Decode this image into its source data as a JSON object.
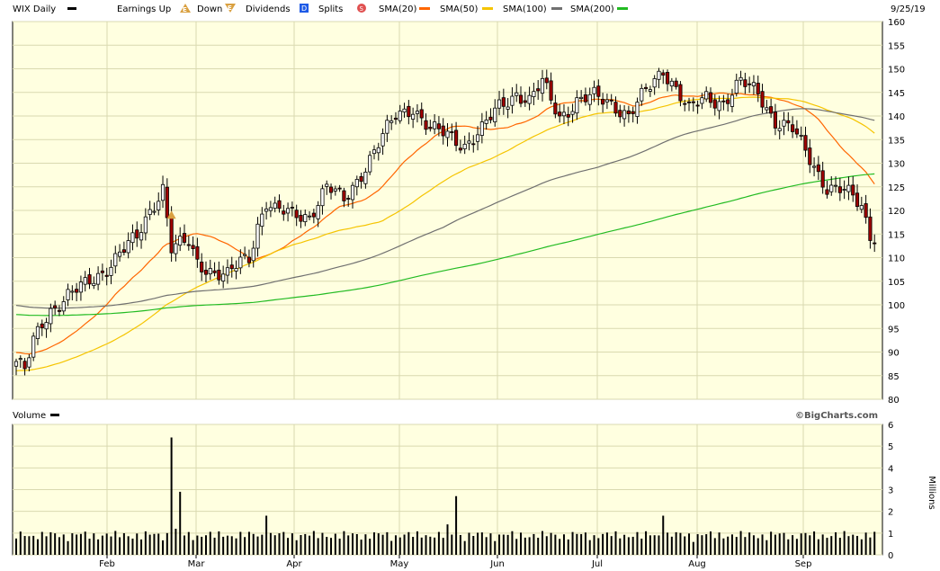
{
  "header": {
    "ticker_label": "WIX Daily",
    "earnings_up_label": "Earnings Up",
    "down_label": "Down",
    "dividends_label": "Dividends",
    "splits_label": "Splits",
    "date": "9/25/19",
    "earnings_marker_letter": "E",
    "dividend_marker_letter": "D",
    "split_marker_letter": "S"
  },
  "volume_header": {
    "label": "Volume"
  },
  "watermark": "©BigCharts.com",
  "colors": {
    "plot_bg": "#ffffe0",
    "grid": "#d9d9b0",
    "up_candle": "#ffffff",
    "down_candle": "#a00000",
    "sma20": "#ff6600",
    "sma50": "#f5c400",
    "sma100": "#707070",
    "sma200": "#22bb22",
    "earnings_marker": "#d9a040",
    "dividend_marker": "#1e5ae6",
    "split_marker": "#e05050"
  },
  "chart_data": [
    {
      "type": "candlestick",
      "title": "WIX Daily",
      "date_range": [
        "2019-01-16",
        "2019-09-25"
      ],
      "ylim": [
        80,
        160
      ],
      "y_ticks": [
        80,
        85,
        90,
        95,
        100,
        105,
        110,
        115,
        120,
        125,
        130,
        135,
        140,
        145,
        150,
        155,
        160
      ],
      "x_tick_labels": [
        "Feb",
        "Mar",
        "Apr",
        "May",
        "Jun",
        "Jul",
        "Aug",
        "Sep"
      ],
      "grid": true,
      "legend": [
        "SMA(20)",
        "SMA(50)",
        "SMA(100)",
        "SMA(200)"
      ],
      "price_anchors": [
        {
          "d": 0,
          "c": 88
        },
        {
          "d": 2,
          "c": 86
        },
        {
          "d": 4,
          "c": 92
        },
        {
          "d": 6,
          "c": 96
        },
        {
          "d": 8,
          "c": 99
        },
        {
          "d": 12,
          "c": 102
        },
        {
          "d": 16,
          "c": 104
        },
        {
          "d": 20,
          "c": 107
        },
        {
          "d": 24,
          "c": 111
        },
        {
          "d": 28,
          "c": 114
        },
        {
          "d": 31,
          "c": 120
        },
        {
          "d": 34,
          "c": 125
        },
        {
          "d": 36,
          "c": 112
        },
        {
          "d": 40,
          "c": 113
        },
        {
          "d": 42,
          "c": 109
        },
        {
          "d": 46,
          "c": 107
        },
        {
          "d": 49,
          "c": 106
        },
        {
          "d": 52,
          "c": 109
        },
        {
          "d": 54,
          "c": 110
        },
        {
          "d": 56,
          "c": 117
        },
        {
          "d": 58,
          "c": 122
        },
        {
          "d": 60,
          "c": 120
        },
        {
          "d": 64,
          "c": 119
        },
        {
          "d": 68,
          "c": 119
        },
        {
          "d": 72,
          "c": 125
        },
        {
          "d": 76,
          "c": 122
        },
        {
          "d": 80,
          "c": 128
        },
        {
          "d": 84,
          "c": 134
        },
        {
          "d": 88,
          "c": 140
        },
        {
          "d": 92,
          "c": 142
        },
        {
          "d": 96,
          "c": 137
        },
        {
          "d": 100,
          "c": 136
        },
        {
          "d": 104,
          "c": 134
        },
        {
          "d": 108,
          "c": 137
        },
        {
          "d": 112,
          "c": 142
        },
        {
          "d": 116,
          "c": 145
        },
        {
          "d": 119,
          "c": 143
        },
        {
          "d": 122,
          "c": 147
        },
        {
          "d": 126,
          "c": 140
        },
        {
          "d": 130,
          "c": 143
        },
        {
          "d": 134,
          "c": 144
        },
        {
          "d": 138,
          "c": 143
        },
        {
          "d": 142,
          "c": 140
        },
        {
          "d": 146,
          "c": 145
        },
        {
          "d": 150,
          "c": 150
        },
        {
          "d": 153,
          "c": 146
        },
        {
          "d": 156,
          "c": 141
        },
        {
          "d": 160,
          "c": 144
        },
        {
          "d": 164,
          "c": 143
        },
        {
          "d": 168,
          "c": 147
        },
        {
          "d": 172,
          "c": 145
        },
        {
          "d": 176,
          "c": 139
        },
        {
          "d": 180,
          "c": 137
        },
        {
          "d": 184,
          "c": 131
        },
        {
          "d": 188,
          "c": 125
        },
        {
          "d": 192,
          "c": 124
        },
        {
          "d": 196,
          "c": 121
        },
        {
          "d": 198,
          "c": 115
        }
      ],
      "series": [
        {
          "name": "SMA(20)"
        },
        {
          "name": "SMA(50)"
        },
        {
          "name": "SMA(100)"
        },
        {
          "name": "SMA(200)"
        }
      ]
    },
    {
      "type": "bar",
      "title": "Volume",
      "ylabel": "Millions",
      "ylim": [
        0,
        6
      ],
      "y_ticks": [
        0,
        1,
        2,
        3,
        4,
        5,
        6
      ],
      "spikes": [
        {
          "d": 36,
          "v": 5.4
        },
        {
          "d": 38,
          "v": 2.9
        },
        {
          "d": 35,
          "v": 1.0
        },
        {
          "d": 58,
          "v": 1.8
        },
        {
          "d": 102,
          "v": 2.7
        },
        {
          "d": 100,
          "v": 1.4
        },
        {
          "d": 150,
          "v": 1.8
        },
        {
          "d": 37,
          "v": 1.2
        }
      ],
      "baseline_v": 0.55
    }
  ]
}
